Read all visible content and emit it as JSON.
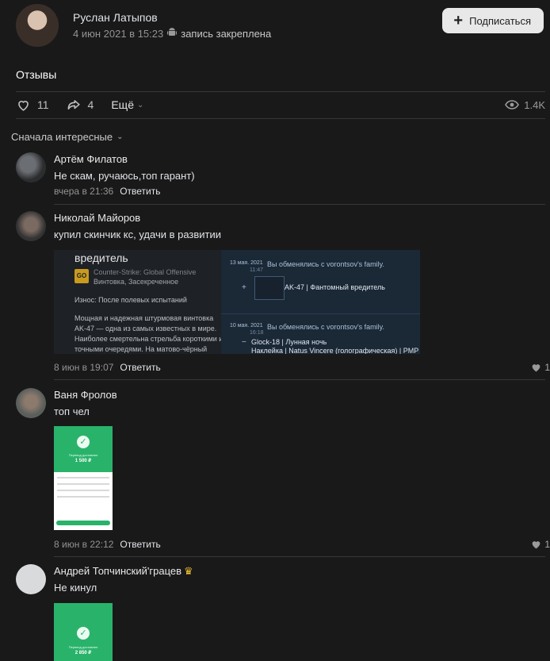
{
  "post": {
    "author": "Руслан Латыпов",
    "date": "4 июн 2021 в 15:23",
    "pinned_label": "запись закреплена",
    "subscribe_label": "Подписаться",
    "text": "Отзывы",
    "likes": "11",
    "shares": "4",
    "more_label": "Ещё",
    "views": "1.4K"
  },
  "sort_label": "Сначала интересные",
  "reply_label": "Ответить",
  "comments": [
    {
      "name": "Артём Филатов",
      "text": "Не скам, ручаюсь,топ гарант)",
      "time": "вчера в 21:36"
    },
    {
      "name": "Николай Майоров",
      "text": "купил скинчик кс, удачи в развитии",
      "time": "8 июн в 19:07",
      "likes": "1",
      "attachment_left": {
        "title": "вредитель",
        "game": "Counter-Strike: Global Offensive",
        "type": "Винтовка, Засекреченное",
        "wear": "Износ: После полевых испытаний",
        "desc": "Мощная и надежная штурмовая винтовка AK-47 — одна из самых известных в мире. Наиболее смертельна стрельба короткими и точными очередями. На матово-чёрный"
      },
      "attachment_right": {
        "date1": "13 мая. 2021",
        "time1": "11:47",
        "line1": "Вы обменялись с vorontsov's family.",
        "item1": "AK-47 | Фантомный вредитель",
        "date2": "10 мая. 2021",
        "time2": "16:18",
        "line2": "Вы обменялись с vorontsov's family.",
        "item2": "Glock-18 | Лунная ночь",
        "item3": "Наклейка | Natus Vincere (голографическая) | PMP"
      }
    },
    {
      "name": "Ваня Фролов",
      "text": "топ чел",
      "time": "8 июн в 22:12",
      "likes": "1",
      "receipt_title": "Перевод доставлен",
      "receipt_amount": "1 500 ₽"
    },
    {
      "name": "Андрей Топчинский'грацев",
      "text": "Не кинул",
      "receipt_title": "Перевод доставлен",
      "receipt_amount": "2 850 ₽"
    }
  ],
  "colors": {
    "background": "#19191a",
    "divider": "#363738",
    "receipt_green": "#29b36a"
  }
}
